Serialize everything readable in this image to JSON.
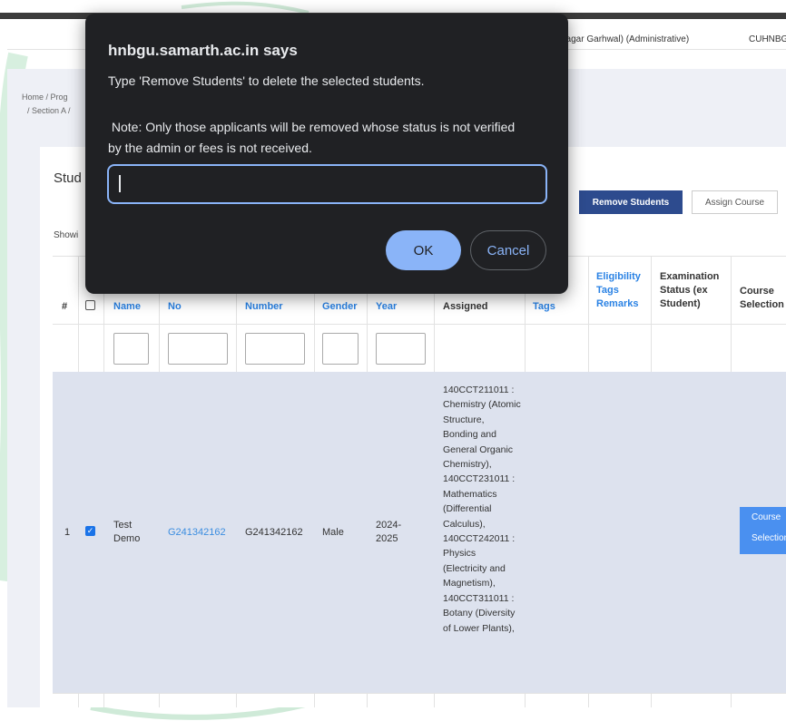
{
  "dialog": {
    "title": "hnbgu.samarth.ac.in says",
    "message": "Type 'Remove Students' to delete the selected students.",
    "note": " Note: Only those applicants will be removed whose status is not verified by the admin or fees is not received.",
    "input_value": "",
    "ok_label": "OK",
    "cancel_label": "Cancel"
  },
  "header": {
    "user_text": "nagar Garhwal) (Administrative)",
    "brand": "CUHNBGU"
  },
  "breadcrumb": {
    "line1": "Home / Prog",
    "line2": "/ Section A /"
  },
  "card": {
    "title": "Stud",
    "showing": "Showi"
  },
  "actions": {
    "remove_students": "Remove Students",
    "assign_course": "Assign Course"
  },
  "table": {
    "headers": {
      "hash": "#",
      "name": "Name",
      "enrollment": "No",
      "roll": "Number",
      "gender": "Gender",
      "year": "Year",
      "course_assigned": "Assigned",
      "eligibility_tags": "Tags",
      "eligibility_remarks": "Eligibility Tags Remarks",
      "exam_status": "Examination Status (ex Student)",
      "course_selection": "Course Selection"
    },
    "row": {
      "index": "1",
      "name": "Test Demo",
      "enrollment_no": "G241342162",
      "roll_no": "G241342162",
      "gender": "Male",
      "year": "2024-2025",
      "course_assigned": "140CCT211011 : Chemistry (Atomic Structure, Bonding and General Organic Chemistry), 140CCT231011 : Mathematics (Differential Calculus), 140CCT242011 : Physics (Electricity and Magnetism), 140CCT311011 : Botany (Diversity of Lower Plants),",
      "course_selection_label": "Course Selection",
      "checked": true
    }
  },
  "colors": {
    "dialog_bg": "#202124",
    "accent": "#8ab4f8",
    "primary_button": "#2d4b8e",
    "link": "#2a82e4"
  }
}
